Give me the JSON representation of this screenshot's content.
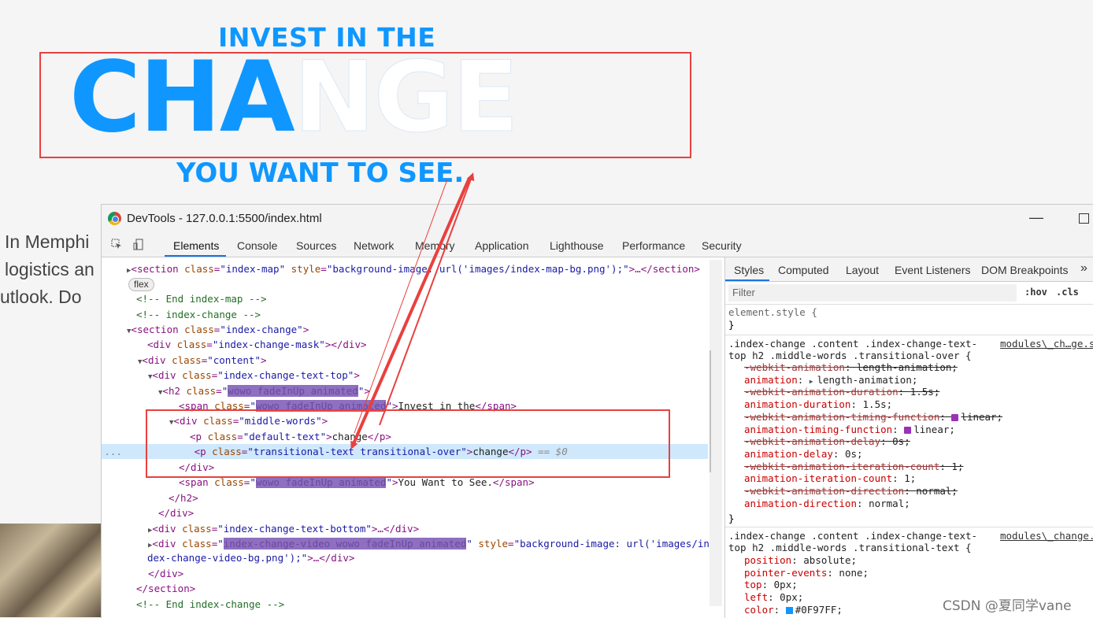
{
  "hero": {
    "top_line": "INVEST IN THE",
    "big_filled": "CHA",
    "big_outline": "NGE",
    "bottom_line": "YOU WANT TO SEE."
  },
  "background_text": {
    "line1": "In Memphi",
    "line2": "logistics an",
    "line3": "utlook. Do"
  },
  "devtools": {
    "title": "DevTools - 127.0.0.1:5500/index.html",
    "tabs": [
      "Elements",
      "Console",
      "Sources",
      "Network",
      "Memory",
      "Application",
      "Lighthouse",
      "Performance",
      "Security"
    ],
    "active_tab": "Elements",
    "styles_tabs": [
      "Styles",
      "Computed",
      "Layout",
      "Event Listeners",
      "DOM Breakpoints"
    ],
    "more_tabs": "»",
    "filter_placeholder": "Filter",
    "hov": ":hov",
    "cls": ".cls"
  },
  "dom": {
    "l1_tag": "<section ",
    "l1_attr1": "class",
    "l1_val1": "\"index-map\"",
    "l1_attr2": "style",
    "l1_val2": "\"background-image: url('images/index-map-bg.png');\"",
    "l1_end": ">…</section>",
    "l2_badge": "flex",
    "l3": "<!-- End index-map -->",
    "l4": "<!-- index-change -->",
    "l5_val": "\"index-change\"",
    "l6_val": "\"index-change-mask\"",
    "l7_val": "\"content\"",
    "l8_val": "\"index-change-text-top\"",
    "l9_val": "wowo fadeInUp animated",
    "l10_val": "wowo fadeInUp animated",
    "l10_text": "Invest in the",
    "l11_val": "\"middle-words\"",
    "l12_val": "\"default-text\"",
    "l12_text": "change",
    "l13_val": "\"transitional-text transitional-over\"",
    "l13_text": "change",
    "l13_dollar": "== $0",
    "l15_val": "wowo fadeInUp animated",
    "l15_text": "You Want to See.",
    "l18_val": "\"index-change-text-bottom\"",
    "l19_val": "index-change-video wowo fadeInUp animated",
    "l19_style": "\"background-image: url('images/in",
    "l20_cont": "dex-change-video-bg.png');\"",
    "l23": "<!-- End index-change -->",
    "row_dots": "..."
  },
  "styles": {
    "element_style": "element.style {",
    "close_brace": "}",
    "rule1_selector_a": ".index-change .content .index-change-text-",
    "rule1_selector_b": "top h2 .middle-words .transitional-over {",
    "rule1_source": "modules\\_ch…ge.s",
    "rule1_props": [
      {
        "p": "-webkit-animation",
        "v": "length-animation;",
        "strike": true
      },
      {
        "p": "animation",
        "v": "length-animation;",
        "strike": false,
        "tri": true
      },
      {
        "p": "-webkit-animation-duration",
        "v": "1.5s;",
        "strike": true
      },
      {
        "p": "animation-duration",
        "v": "1.5s;",
        "strike": false
      },
      {
        "p": "-webkit-animation-timing-function",
        "v": "linear;",
        "strike": true,
        "ease": true
      },
      {
        "p": "animation-timing-function",
        "v": "linear;",
        "strike": false,
        "ease": true
      },
      {
        "p": "-webkit-animation-delay",
        "v": "0s;",
        "strike": true
      },
      {
        "p": "animation-delay",
        "v": "0s;",
        "strike": false
      },
      {
        "p": "-webkit-animation-iteration-count",
        "v": "1;",
        "strike": true
      },
      {
        "p": "animation-iteration-count",
        "v": "1;",
        "strike": false
      },
      {
        "p": "-webkit-animation-direction",
        "v": "normal;",
        "strike": true
      },
      {
        "p": "animation-direction",
        "v": "normal;",
        "strike": false
      }
    ],
    "rule2_selector_a": ".index-change .content .index-change-text-",
    "rule2_selector_b": "top h2 .middle-words .transitional-text {",
    "rule2_source": "modules\\_change.",
    "rule2_props": [
      {
        "p": "position",
        "v": "absolute;"
      },
      {
        "p": "pointer-events",
        "v": "none;"
      },
      {
        "p": "top",
        "v": "0px;"
      },
      {
        "p": "left",
        "v": "0px;"
      },
      {
        "p": "color",
        "v": "#0F97FF;",
        "swatch": "#0F97FF"
      }
    ]
  },
  "watermark": "CSDN @夏同学vane",
  "colors": {
    "accent": "#0f97ff",
    "annotation": "#e9403f",
    "devtools_blue": "#1a73e8"
  }
}
